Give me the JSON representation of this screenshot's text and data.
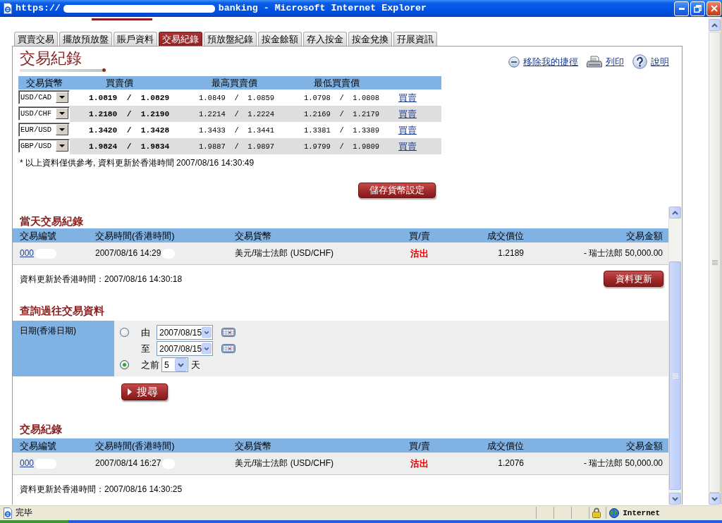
{
  "window": {
    "title_prefix": "https://",
    "redacted": true,
    "title_suffix": "banking - Microsoft Internet Explorer"
  },
  "tabs": [
    {
      "label": "買賣交易",
      "selected": false
    },
    {
      "label": "擺放預放盤",
      "selected": false
    },
    {
      "label": "賬戶資料",
      "selected": false
    },
    {
      "label": "交易紀錄",
      "selected": true
    },
    {
      "label": "預放盤紀錄",
      "selected": false
    },
    {
      "label": "按金餘額",
      "selected": false
    },
    {
      "label": "存入按金",
      "selected": false
    },
    {
      "label": "按金兌換",
      "selected": false
    },
    {
      "label": "孖展資訊",
      "selected": false
    }
  ],
  "page_title": "交易紀錄",
  "shortcuts": [
    {
      "kind": "remove",
      "label": "移除我的捷徑"
    },
    {
      "kind": "print",
      "label": "列印"
    },
    {
      "kind": "help",
      "label": "說明"
    }
  ],
  "rates": {
    "columns": [
      "交易貨幣",
      "買賣價",
      "最高買賣價",
      "最低買賣價"
    ],
    "rows": [
      {
        "currency": "USD/CAD",
        "price": "1.0819  /  1.0829",
        "high": "1.0849  /  1.0859",
        "low": "1.0798  /  1.0808",
        "action": "買賣"
      },
      {
        "currency": "USD/CHF",
        "price": "1.2180  /  1.2190",
        "high": "1.2214  /  1.2224",
        "low": "1.2169  /  1.2179",
        "action": "買賣"
      },
      {
        "currency": "EUR/USD",
        "price": "1.3420  /  1.3428",
        "high": "1.3433  /  1.3441",
        "low": "1.3381  /  1.3389",
        "action": "買賣"
      },
      {
        "currency": "GBP/USD",
        "price": "1.9824  /  1.9834",
        "high": "1.9887  /  1.9897",
        "low": "1.9799  /  1.9809",
        "action": "買賣"
      }
    ],
    "note": "* 以上資料僅供參考, 資料更新於香港時間 2007/08/16 14:30:49",
    "save_button": "儲存貨幣設定"
  },
  "today": {
    "title": "當天交易紀錄",
    "columns": [
      "交易編號",
      "交易時間(香港時間)",
      "交易貨幣",
      "買/賣",
      "成交價位",
      "交易金額"
    ],
    "rows": [
      {
        "id": "000",
        "time": "2007/08/16 14:29",
        "redacted": true,
        "pair": "美元/瑞士法郎 (USD/CHF)",
        "side": "沽出",
        "price": "1.2189",
        "amount": "- 瑞士法郎 50,000.00"
      }
    ],
    "updated": "資料更新於香港時間：2007/08/16 14:30:18",
    "refresh_button": "資料更新"
  },
  "query": {
    "title": "查詢過往交易資料",
    "label": "日期(香港日期)",
    "options": [
      {
        "kind": "range",
        "selected": false,
        "from_label": "由",
        "from": "2007/08/15",
        "to_label": "至",
        "to": "2007/08/15"
      },
      {
        "kind": "days",
        "selected": true,
        "prefix": "之前",
        "value": "5",
        "suffix": "天"
      }
    ],
    "search_button": "搜尋"
  },
  "history": {
    "title": "交易紀錄",
    "columns": [
      "交易編號",
      "交易時間(香港時間)",
      "交易貨幣",
      "買/賣",
      "成交價位",
      "交易金額"
    ],
    "rows": [
      {
        "id": "000",
        "time": "2007/08/14 16:27",
        "redacted": true,
        "pair": "美元/瑞士法郎 (USD/CHF)",
        "side": "沽出",
        "price": "1.2076",
        "amount": "- 瑞士法郎 50,000.00"
      }
    ],
    "updated": "資料更新於香港時間：2007/08/16 14:30:25"
  },
  "status_bar": {
    "text": "完毕",
    "zone": "Internet"
  }
}
